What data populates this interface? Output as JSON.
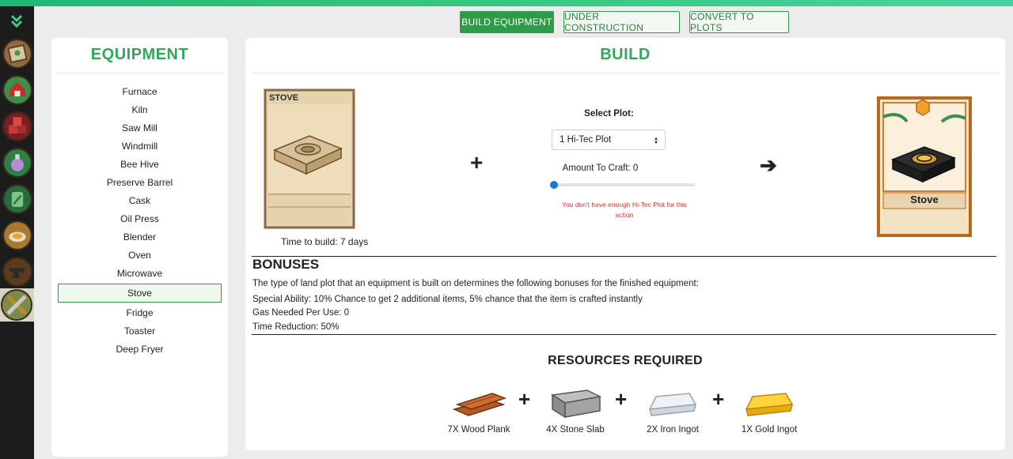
{
  "colors": {
    "accent": "#2f9a48",
    "title_green": "#32a85a",
    "warning": "#dd3333",
    "rail": "#1c1c1c"
  },
  "rail": {
    "toggle_icon": "double-chevron-down-icon",
    "items": [
      "map-icon",
      "barn-icon",
      "crates-icon",
      "potion-icon",
      "jar-icon",
      "cooking-icon",
      "anvil-icon",
      "tools-icon"
    ]
  },
  "tabs": [
    {
      "label": "BUILD EQUIPMENT",
      "active": true
    },
    {
      "label": "UNDER CONSTRUCTION",
      "active": false
    },
    {
      "label": "CONVERT TO PLOTS",
      "active": false
    }
  ],
  "equipment": {
    "title": "EQUIPMENT",
    "items": [
      "Furnace",
      "Kiln",
      "Saw Mill",
      "Windmill",
      "Bee Hive",
      "Preserve Barrel",
      "Cask",
      "Oil Press",
      "Blender",
      "Oven",
      "Microwave",
      "Stove",
      "Fridge",
      "Toaster",
      "Deep Fryer"
    ],
    "selected": "Stove"
  },
  "build": {
    "title": "BUILD",
    "card_title": "STOVE",
    "time_to_build": "Time to build: 7 days",
    "select_label": "Select Plot:",
    "select_value": "1 Hi-Tec Plot",
    "amount_label": "Amount To Craft: 0",
    "amount": 0,
    "warning": "You don't have enough Hi-Tec Plot for this action",
    "result_label": "Stove"
  },
  "bonuses": {
    "title": "BONUSES",
    "intro": "The type of land plot that an equipment is built on determines the following bonuses for the finished equipment:",
    "special": "Special Ability: 10% Chance to get 2 additional items, 5% chance that the item is crafted instantly",
    "gas": "Gas Needed Per Use: 0",
    "time": "Time Reduction: 50%"
  },
  "resources": {
    "title": "RESOURCES REQUIRED",
    "items": [
      {
        "label": "7X Wood Plank",
        "icon": "wood-plank-icon"
      },
      {
        "label": "4X Stone Slab",
        "icon": "stone-slab-icon"
      },
      {
        "label": "2X Iron Ingot",
        "icon": "iron-ingot-icon"
      },
      {
        "label": "1X Gold Ingot",
        "icon": "gold-ingot-icon"
      }
    ]
  }
}
